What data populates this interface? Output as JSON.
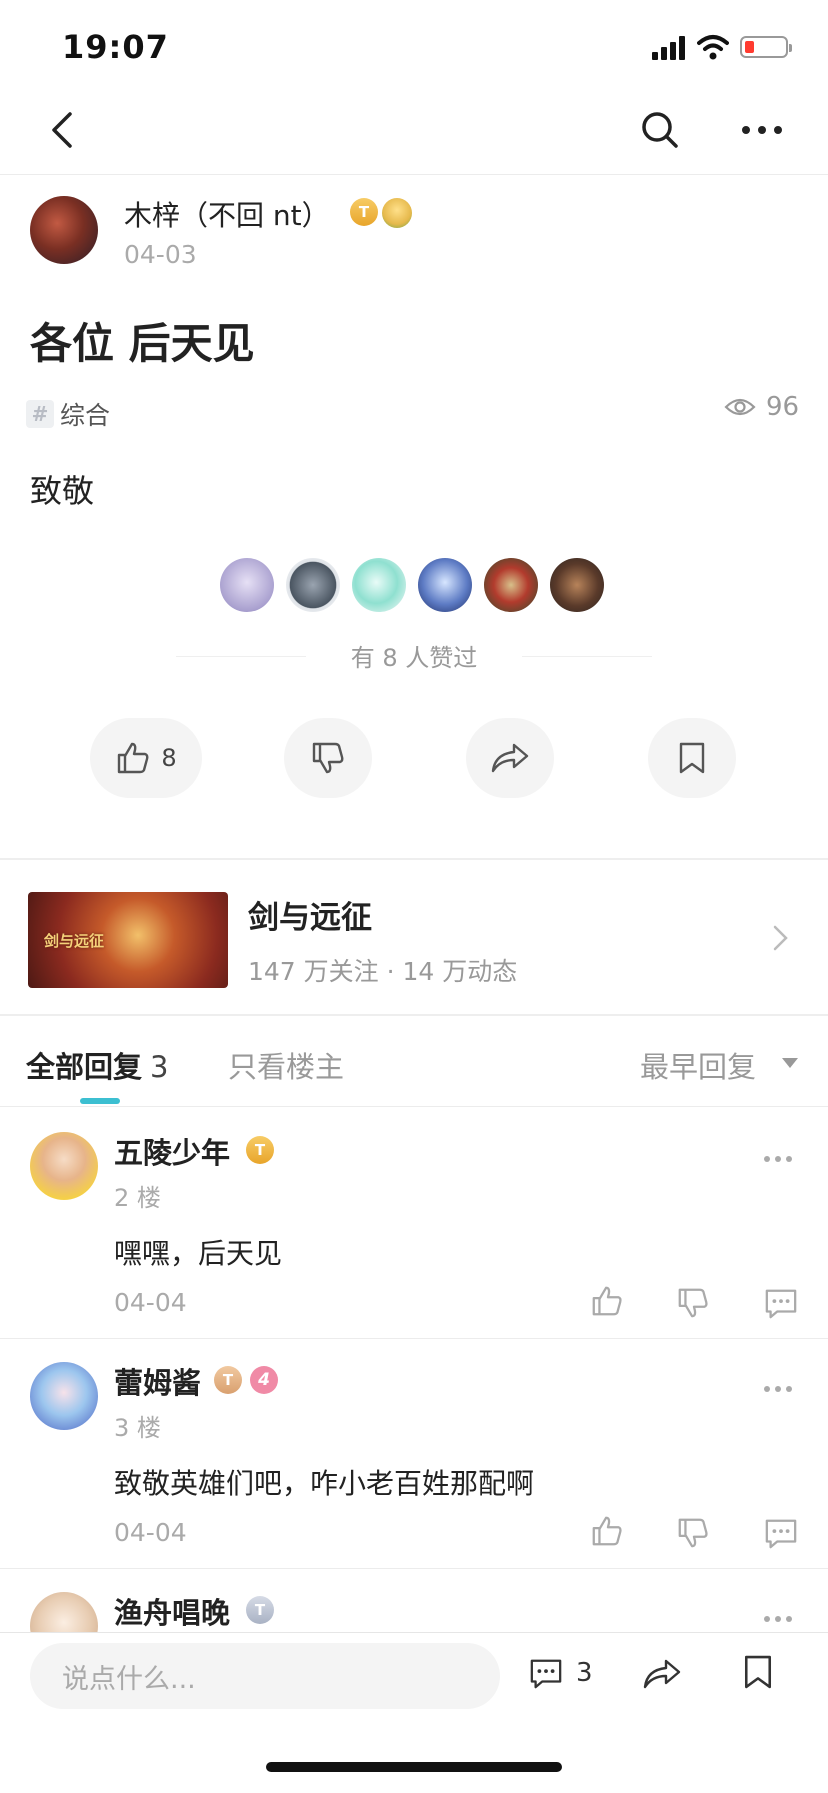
{
  "status_bar": {
    "time": "19:07"
  },
  "post": {
    "author": {
      "name": "木梓（不回 nt）",
      "date": "04-03",
      "badge_tier": "T"
    },
    "title": "各位 后天见",
    "tag": {
      "label": "综合"
    },
    "views": "96",
    "body": "致敬",
    "likers_text": "有 8 人赞过",
    "actions": {
      "like_count": "8"
    }
  },
  "game": {
    "name": "剑与远征",
    "stats": "147 万关注 · 14 万动态",
    "cover_text": "剑与远征"
  },
  "replies_tabs": {
    "all_label": "全部回复",
    "all_count": "3",
    "op_only": "只看楼主",
    "sort_label": "最早回复"
  },
  "comments": [
    {
      "name": "五陵少年",
      "floor": "2 楼",
      "text": "嘿嘿，后天见",
      "date": "04-04",
      "badge_tier": "T"
    },
    {
      "name": "蕾姆酱",
      "floor": "3 楼",
      "text": "致敬英雄们吧，咋小老百姓那配啊",
      "date": "04-04",
      "badge_tier": "T",
      "badge_level": "4"
    },
    {
      "name": "渔舟唱晚",
      "badge_tier": "T"
    }
  ],
  "bottom_bar": {
    "input_placeholder": "说点什么...",
    "comment_count": "3"
  },
  "colors": {
    "accent": "#3cbfd1",
    "text_primary": "#222222",
    "text_secondary": "#999999",
    "badge_gold": "#e8a52b"
  }
}
